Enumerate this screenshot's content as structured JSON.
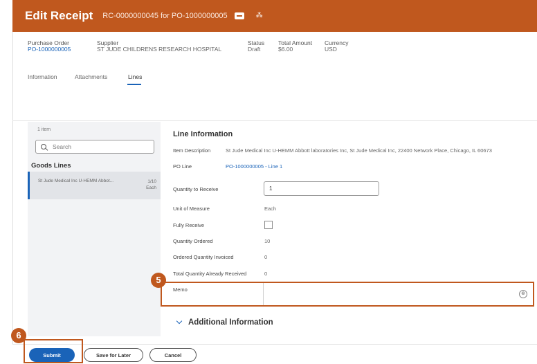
{
  "header": {
    "title": "Edit Receipt",
    "subtitle": "RC-0000000045 for PO-1000000005",
    "related_icon_text": "⁂"
  },
  "summary": {
    "purchase_order_label": "Purchase Order",
    "purchase_order_value": "PO-1000000005",
    "supplier_label": "Supplier",
    "supplier_value": "ST JUDE CHILDRENS RESEARCH HOSPITAL",
    "status_label": "Status",
    "status_value": "Draft",
    "total_label": "Total Amount",
    "total_value": "$6.00",
    "currency_label": "Currency",
    "currency_value": "USD"
  },
  "tabs": [
    {
      "label": "Information"
    },
    {
      "label": "Attachments"
    },
    {
      "label": "Lines",
      "active": true
    }
  ],
  "left_panel": {
    "item_count": "1 item",
    "search_placeholder": "Search",
    "section_title": "Goods Lines",
    "line_item": {
      "description": "St Jude Medical Inc U-HEMM Abbot...",
      "quantity": "1/10",
      "unit": "Each"
    }
  },
  "line_information": {
    "heading": "Line Information",
    "item_description_label": "Item Description",
    "item_description_value": "St Jude Medical Inc U-HEMM Abbott laboratories Inc, St Jude Medical Inc, 22400 Network Place, Chicago, IL 60673",
    "po_line_label": "PO Line",
    "po_line_value": "PO-1000000005 - Line 1",
    "quantity_to_receive_label": "Quantity to Receive",
    "quantity_to_receive_value": "1",
    "unit_of_measure_label": "Unit of Measure",
    "unit_of_measure_value": "Each",
    "fully_receive_label": "Fully Receive",
    "quantity_ordered_label": "Quantity Ordered",
    "quantity_ordered_value": "10",
    "ordered_quantity_invoiced_label": "Ordered Quantity Invoiced",
    "ordered_quantity_invoiced_value": "0",
    "total_quantity_received_label": "Total Quantity Already Received",
    "total_quantity_received_value": "0",
    "memo_label": "Memo",
    "memo_value": "",
    "memo_icon": "⊕"
  },
  "additional_information": {
    "title": "Additional Information"
  },
  "steps": {
    "memo_step": "5",
    "submit_step": "6"
  },
  "footer": {
    "submit_label": "Submit",
    "save_for_later_label": "Save for Later",
    "cancel_label": "Cancel"
  },
  "colors": {
    "header_bg": "#c0581e",
    "highlight": "#c0581e",
    "link": "#1a63b8",
    "primary_button": "#1a63b8"
  }
}
